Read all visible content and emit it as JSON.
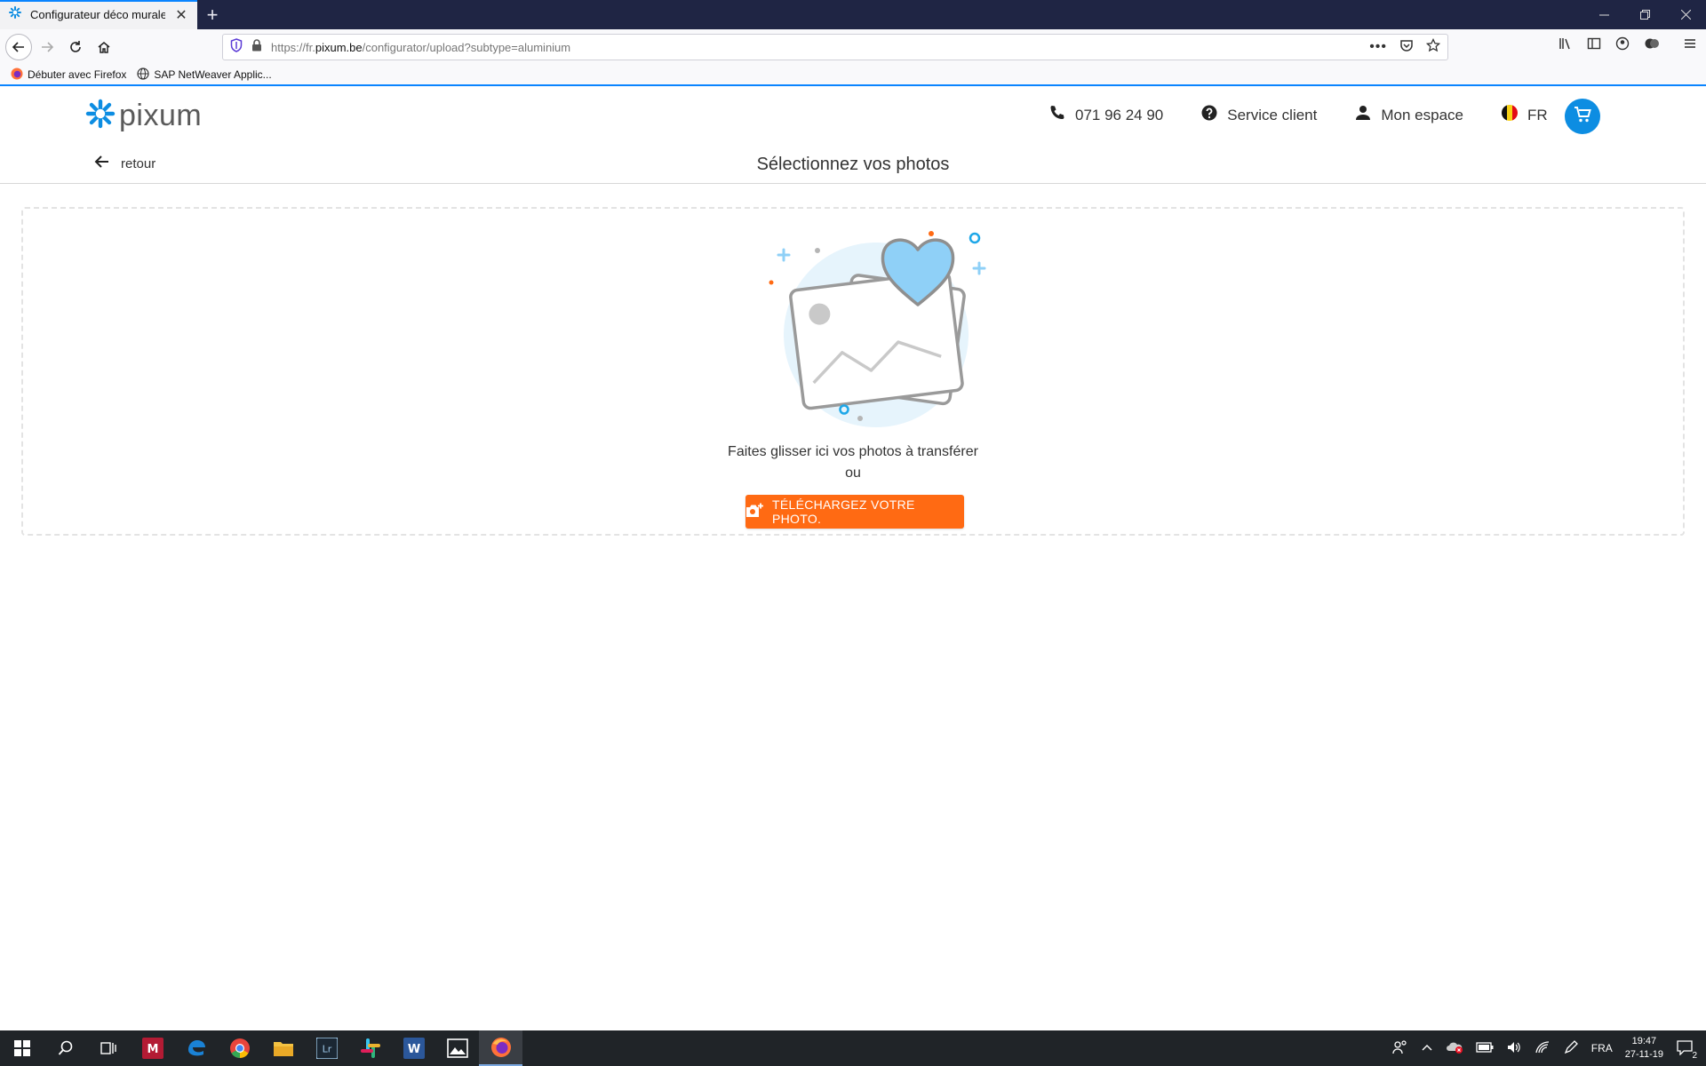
{
  "browser": {
    "tab_title": "Configurateur déco murale",
    "url_prefix": "https://fr.",
    "url_domain": "pixum.be",
    "url_path": "/configurator/upload?subtype=aluminium",
    "bookmarks": [
      {
        "label": "Débuter avec Firefox"
      },
      {
        "label": "SAP NetWeaver Applic..."
      }
    ]
  },
  "header": {
    "logo_text": "pixum",
    "phone": "071 96 24 90",
    "service": "Service client",
    "account": "Mon espace",
    "language": "FR",
    "back_label": "retour",
    "page_title": "Sélectionnez vos photos"
  },
  "dropzone": {
    "drag_text": "Faites glisser ici vos photos à transférer",
    "or_text": "ou",
    "upload_label": "TÉLÉCHARGEZ VOTRE PHOTO."
  },
  "taskbar": {
    "language": "FRA",
    "time": "19:47",
    "date": "27-11-19",
    "notifications": "2"
  },
  "colors": {
    "brand_blue": "#0d8de2",
    "cta_orange": "#ff6a13",
    "titlebar": "#1f2544",
    "heart": "#8fd0f7"
  }
}
